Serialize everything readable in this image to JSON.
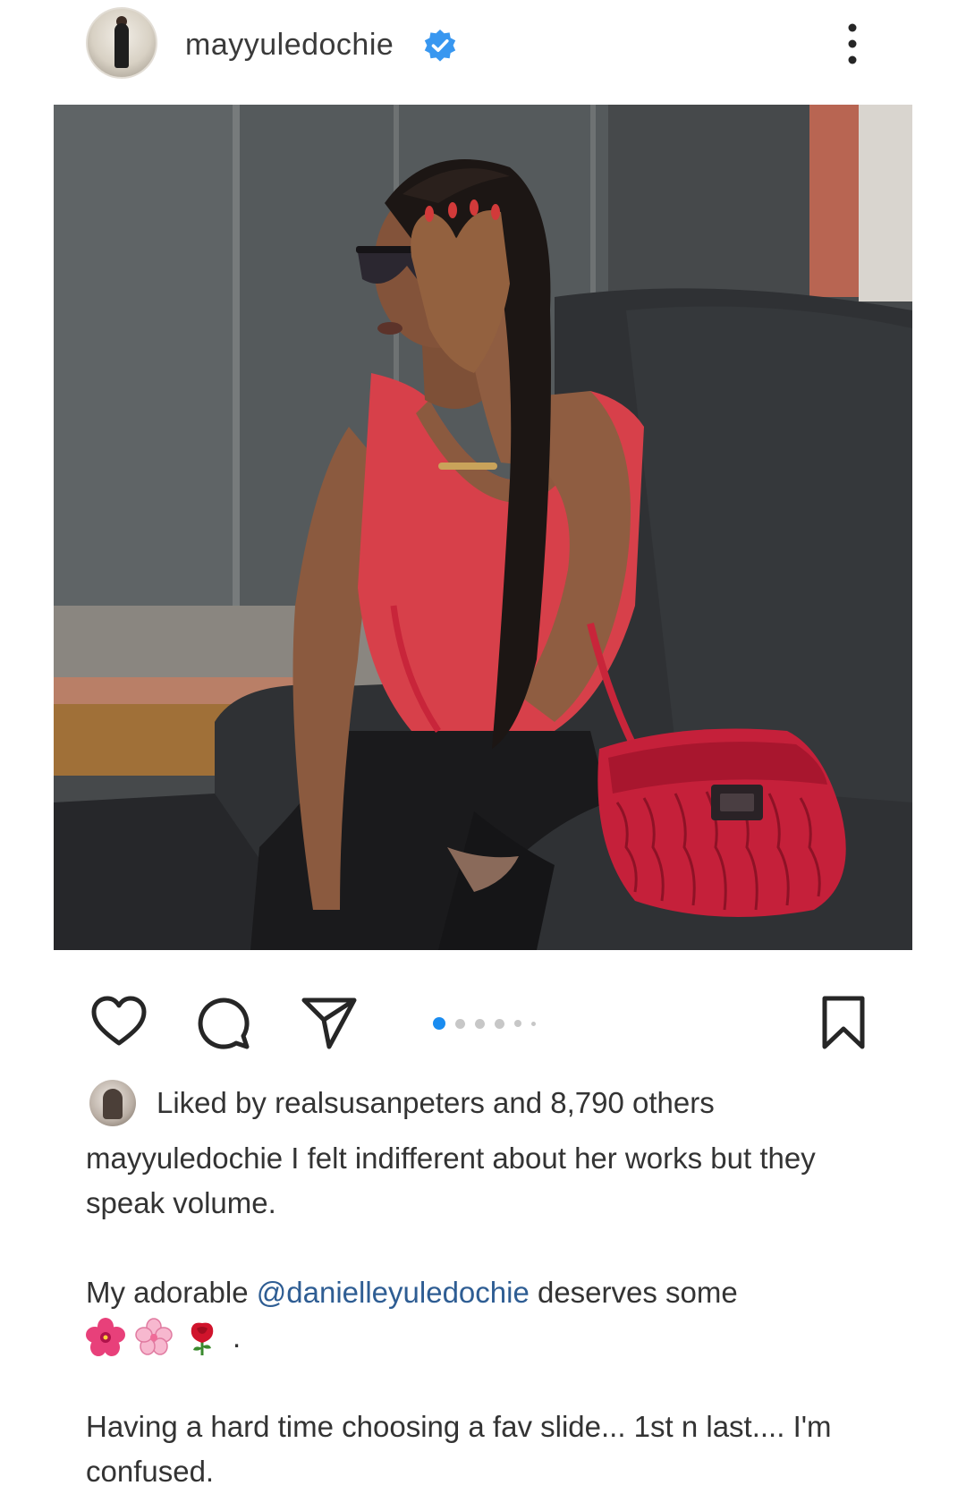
{
  "post": {
    "username": "mayyuledochie",
    "verified": true,
    "accent_color": "#3897f0"
  },
  "carousel": {
    "total_slides_shown": 6,
    "active_index": 0
  },
  "likes": {
    "text": "Liked by realsusanpeters and 8,790 others"
  },
  "caption": {
    "username": "mayyuledochie",
    "line1_text": " I felt indifferent about her works but they speak volume.",
    "line2_prefix": "My adorable ",
    "mention": "@danielleyuledochie",
    "line2_suffix": " deserves some",
    "emojis": [
      "hibiscus-emoji",
      "cherry-blossom-emoji",
      "rose-emoji"
    ],
    "emoji_trail": ".",
    "line3_text": "Having a hard time choosing a fav slide... 1st n last.... I'm confused."
  },
  "icons": {
    "like": "heart-icon",
    "comment": "comment-bubble-icon",
    "share": "paper-plane-icon",
    "save": "bookmark-icon",
    "more": "more-vertical-icon",
    "verified": "verified-badge-icon"
  }
}
